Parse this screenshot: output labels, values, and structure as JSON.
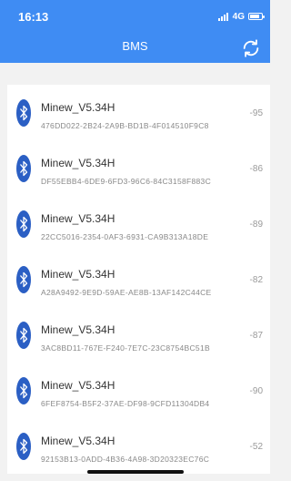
{
  "status": {
    "time": "16:13",
    "network": "4G"
  },
  "header": {
    "title": "BMS",
    "refresh_icon": "refresh-icon"
  },
  "devices": [
    {
      "name": "Minew_V5.34H",
      "uuid": "476DD022-2B24-2A9B-BD1B-4F014510F9C8",
      "rssi": "-95"
    },
    {
      "name": "Minew_V5.34H",
      "uuid": "DF55EBB4-6DE9-6FD3-96C6-84C3158F883C",
      "rssi": "-86"
    },
    {
      "name": "Minew_V5.34H",
      "uuid": "22CC5016-2354-0AF3-6931-CA9B313A18DE",
      "rssi": "-89"
    },
    {
      "name": "Minew_V5.34H",
      "uuid": "A28A9492-9E9D-59AE-AE8B-13AF142C44CE",
      "rssi": "-82"
    },
    {
      "name": "Minew_V5.34H",
      "uuid": "3AC8BD11-767E-F240-7E7C-23C8754BC51B",
      "rssi": "-87"
    },
    {
      "name": "Minew_V5.34H",
      "uuid": "6FEF8754-B5F2-37AE-DF98-9CFD11304DB4",
      "rssi": "-90"
    },
    {
      "name": "Minew_V5.34H",
      "uuid": "92153B13-0ADD-4B36-4A98-3D20323EC76C",
      "rssi": "-52"
    }
  ],
  "colors": {
    "header": "#3f8cf3",
    "bluetooth_icon": "#2b5fc4",
    "background": "#f2f2f2"
  }
}
